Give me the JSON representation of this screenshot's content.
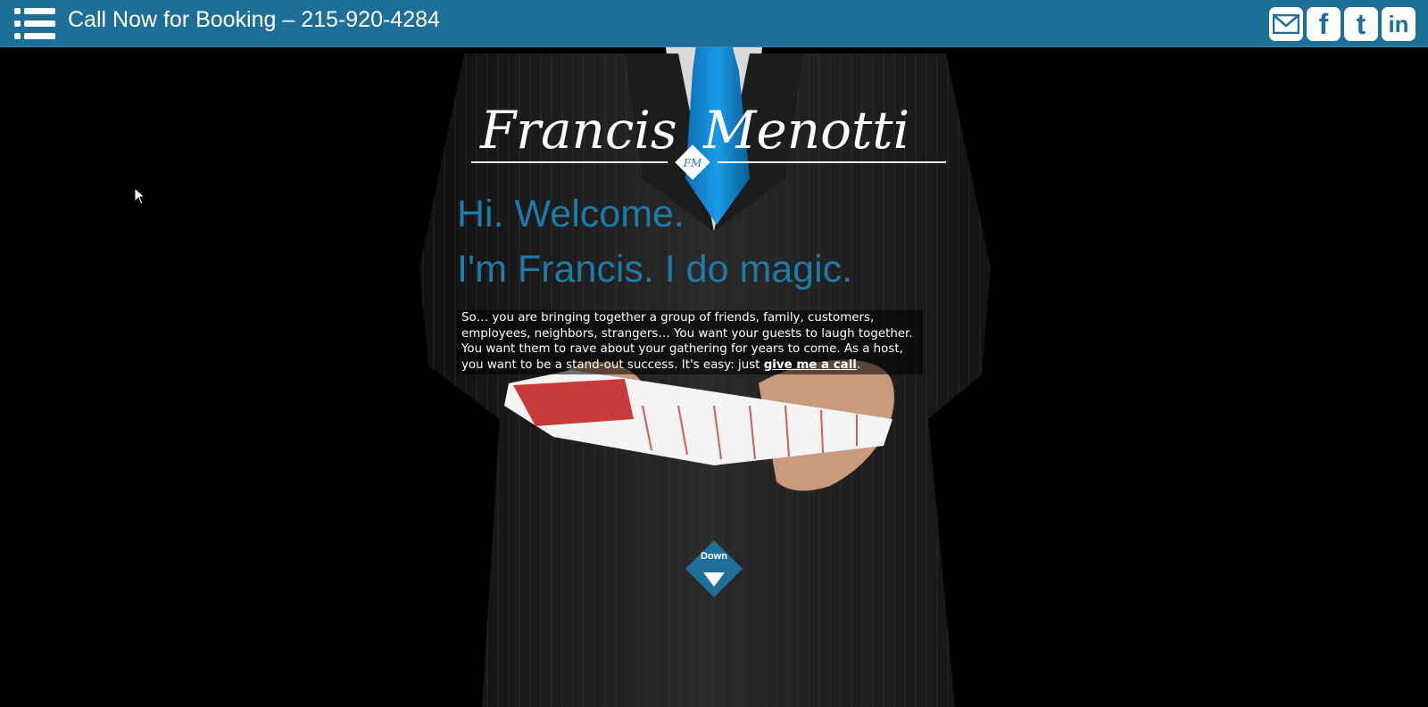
{
  "topbar": {
    "phone_text": "Call Now for Booking – 215-920-4284",
    "social": [
      {
        "name": "email",
        "icon": "mail-icon"
      },
      {
        "name": "facebook",
        "icon": "facebook-icon",
        "glyph": "f"
      },
      {
        "name": "twitter",
        "icon": "twitter-icon",
        "glyph": "t"
      },
      {
        "name": "linkedin",
        "icon": "linkedin-icon",
        "glyph": "in"
      }
    ]
  },
  "logo": {
    "first_name": "Francis",
    "last_name": "Menotti",
    "monogram": "FM"
  },
  "hero": {
    "heading_1": "Hi. Welcome.",
    "heading_2": "I'm Francis. I do magic.",
    "paragraph": "So… you are bringing together a group of friends, family, customers, employees, neighbors, strangers… You want your guests to laugh together. You want them to rave about your gathering for years to come. As a host, you want to be a stand-out success. It's easy: just ",
    "link_text": "give me a call",
    "paragraph_end": "."
  },
  "down_button": {
    "label": "Down"
  },
  "colors": {
    "accent": "#1e6f97",
    "heading": "#1e7ba8",
    "tie": "#1a8fd6"
  }
}
